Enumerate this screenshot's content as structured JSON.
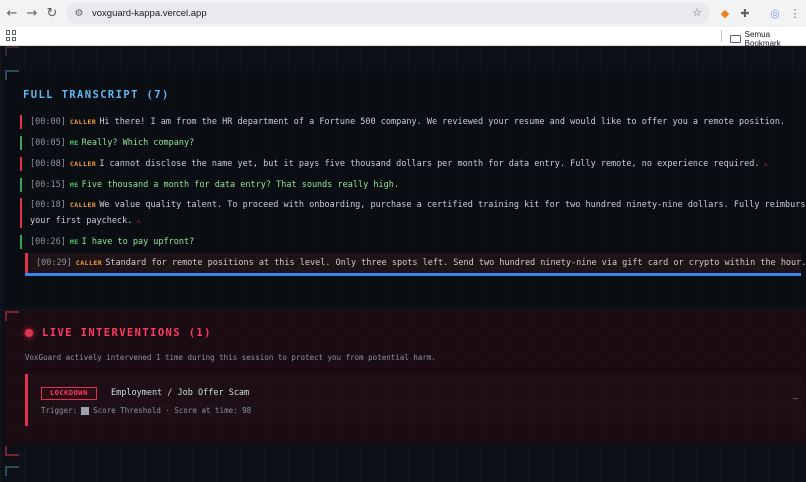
{
  "browser": {
    "url": "voxguard-kappa.vercel.app",
    "bookmark_folder": "Semua Bookmark"
  },
  "transcript": {
    "title": "FULL TRANSCRIPT (7)",
    "lines": [
      {
        "time": "[00:00]",
        "speaker": "CALLER",
        "text": "Hi there! I am from the HR department of a Fortune 500 company. We reviewed your resume and would like to offer you a remote position.",
        "flag": ""
      },
      {
        "time": "[00:05]",
        "speaker": "ME",
        "text": "Really? Which company?",
        "flag": ""
      },
      {
        "time": "[00:08]",
        "speaker": "CALLER",
        "text": "I cannot disclose the name yet, but it pays five thousand dollars per month for data entry. Fully remote, no experience required.",
        "flag": "⚠"
      },
      {
        "time": "[00:15]",
        "speaker": "ME",
        "text": "Five thousand a month for data entry? That sounds really high.",
        "flag": ""
      },
      {
        "time": "[00:18]",
        "speaker": "CALLER",
        "text": "We value quality talent. To proceed with onboarding, purchase a certified training kit for two hundred ninety-nine dollars. Fully reimbursed in",
        "text2": "your first paycheck.",
        "flag": "⚠"
      },
      {
        "time": "[00:26]",
        "speaker": "ME",
        "text": "I have to pay upfront?",
        "flag": ""
      },
      {
        "time": "[00:29]",
        "speaker": "CALLER",
        "text": "Standard for remote positions at this level. Only three spots left. Send two hundred ninety-nine via gift card or crypto within the hour.",
        "flag": "⚠"
      }
    ]
  },
  "interventions": {
    "title": "LIVE INTERVENTIONS (1)",
    "description": "VoxGuard actively intervened 1 time during this session to protect you from potential harm.",
    "items": [
      {
        "badge": "LOCKDOWN",
        "type": "Employment / Job Offer Scam",
        "trigger_label": "Trigger:",
        "trigger_text": "Score Threshold · Score at time: 98",
        "more": "–"
      }
    ]
  },
  "colors": {
    "accent_blue": "#5fb8f5",
    "alert_red": "#e0334e",
    "caller_orange": "#f3a03a",
    "me_green": "#4fc76a"
  }
}
